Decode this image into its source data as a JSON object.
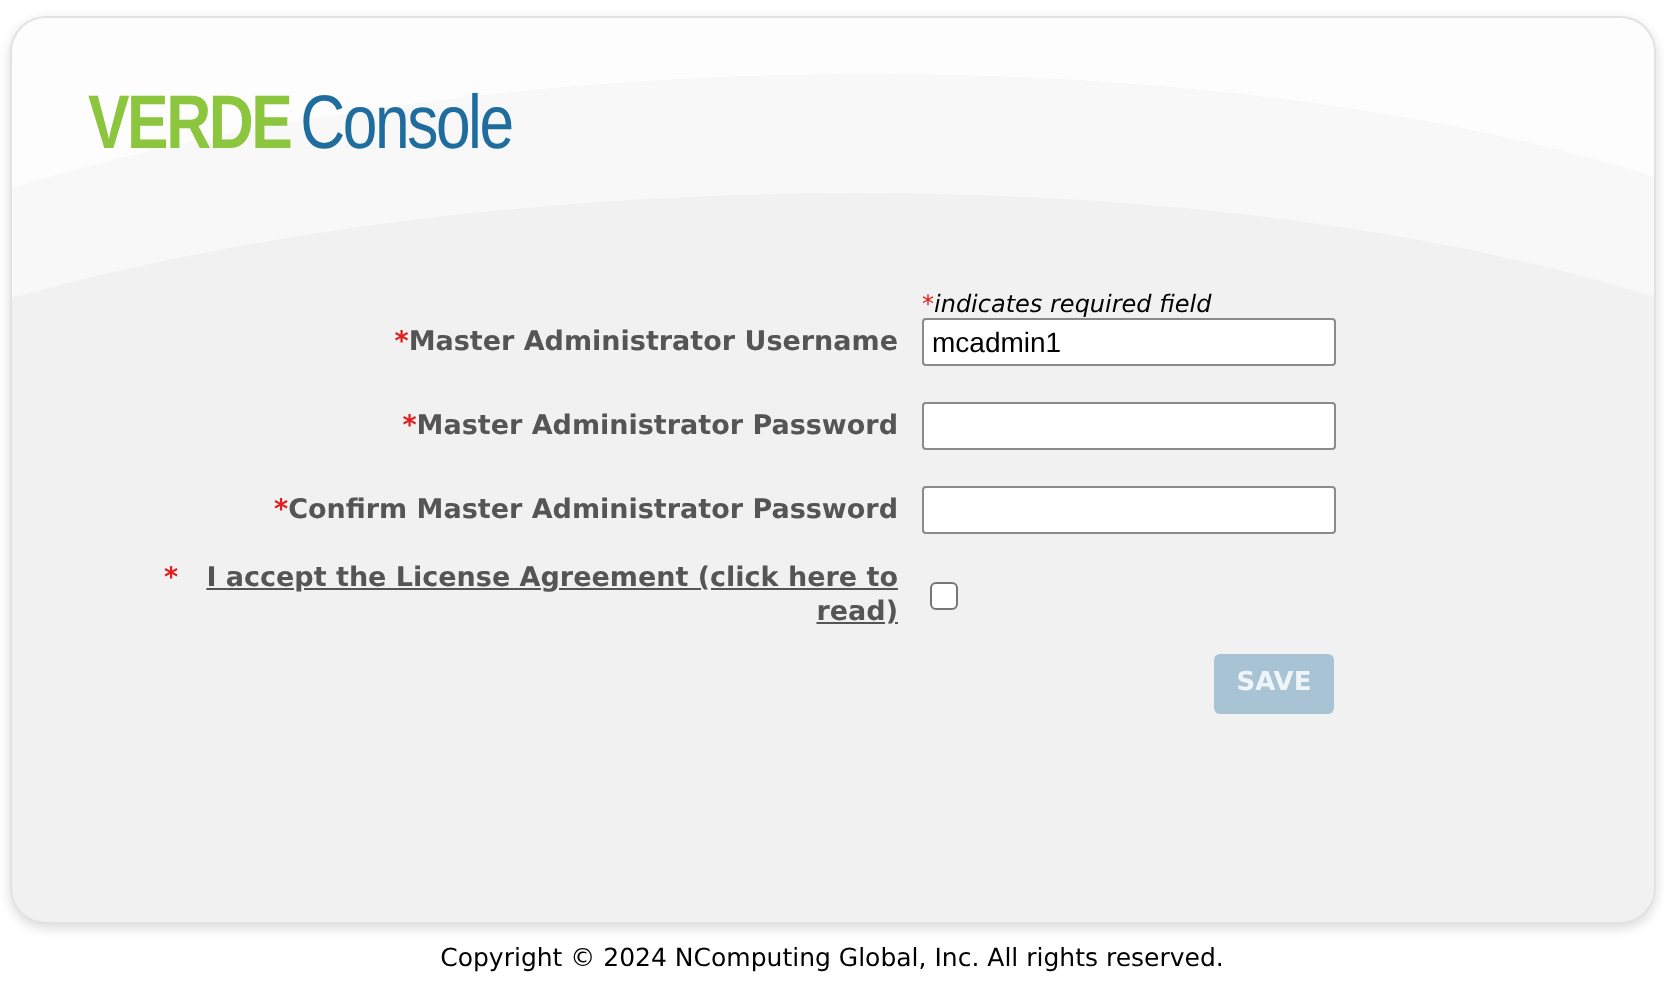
{
  "logo": {
    "brand": "VERDE",
    "product": "Console"
  },
  "required_note": {
    "mark": "*",
    "text": "indicates required field"
  },
  "fields": [
    {
      "mark": "*",
      "label": "Master Administrator Username",
      "value": "mcadmin1"
    },
    {
      "mark": "*",
      "label": "Master Administrator Password"
    },
    {
      "mark": "*",
      "label": "Confirm Master Administrator Password"
    }
  ],
  "license": {
    "mark": "*",
    "link": "I accept the License Agreement (click here to read)",
    "checked": false
  },
  "save_button": {
    "label": "SAVE",
    "disabled": true
  },
  "footer": "Copyright © 2024 NComputing Global, Inc. All rights reserved."
}
